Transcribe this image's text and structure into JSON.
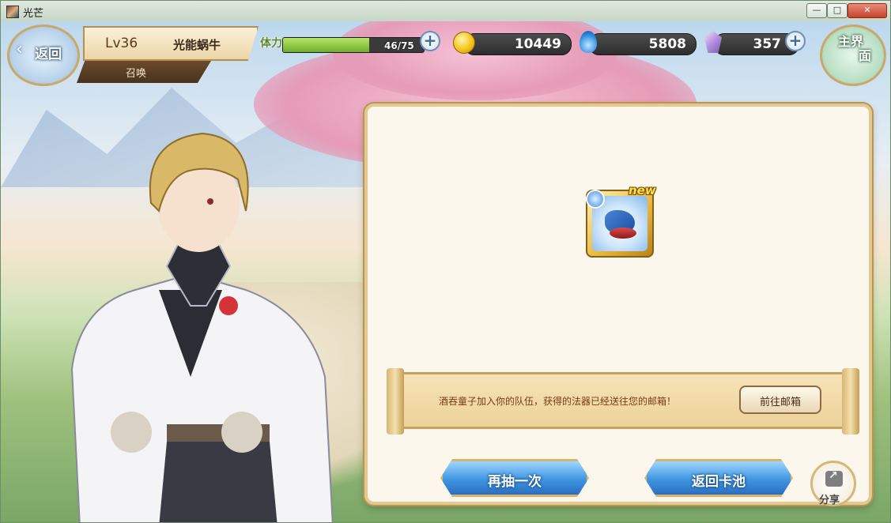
{
  "window": {
    "title": "光芒",
    "minimize": "—",
    "maximize": "□",
    "close": "✕"
  },
  "hud": {
    "back_label": "返回",
    "back_arrow": "‹",
    "level": "Lv36",
    "player_name": "光能蜗牛",
    "mode": "召唤",
    "stamina_label": "体力",
    "stamina_current": 46,
    "stamina_max": 75,
    "stamina_text": "46/75",
    "gold": "10449",
    "spirit": "5808",
    "crystal": "357",
    "home_label_1": "主界",
    "home_label_2": "面"
  },
  "result": {
    "new_badge": "new",
    "message": "酒吞童子加入你的队伍，获得的法器已经送往您的邮箱！",
    "mail_button": "前往邮箱",
    "draw_again": "再抽一次",
    "back_to_pool": "返回卡池",
    "share": "分享"
  },
  "colors": {
    "accent_gold": "#d7b46a",
    "button_blue": "#3f95e0",
    "stamina_green": "#6fae2c"
  }
}
